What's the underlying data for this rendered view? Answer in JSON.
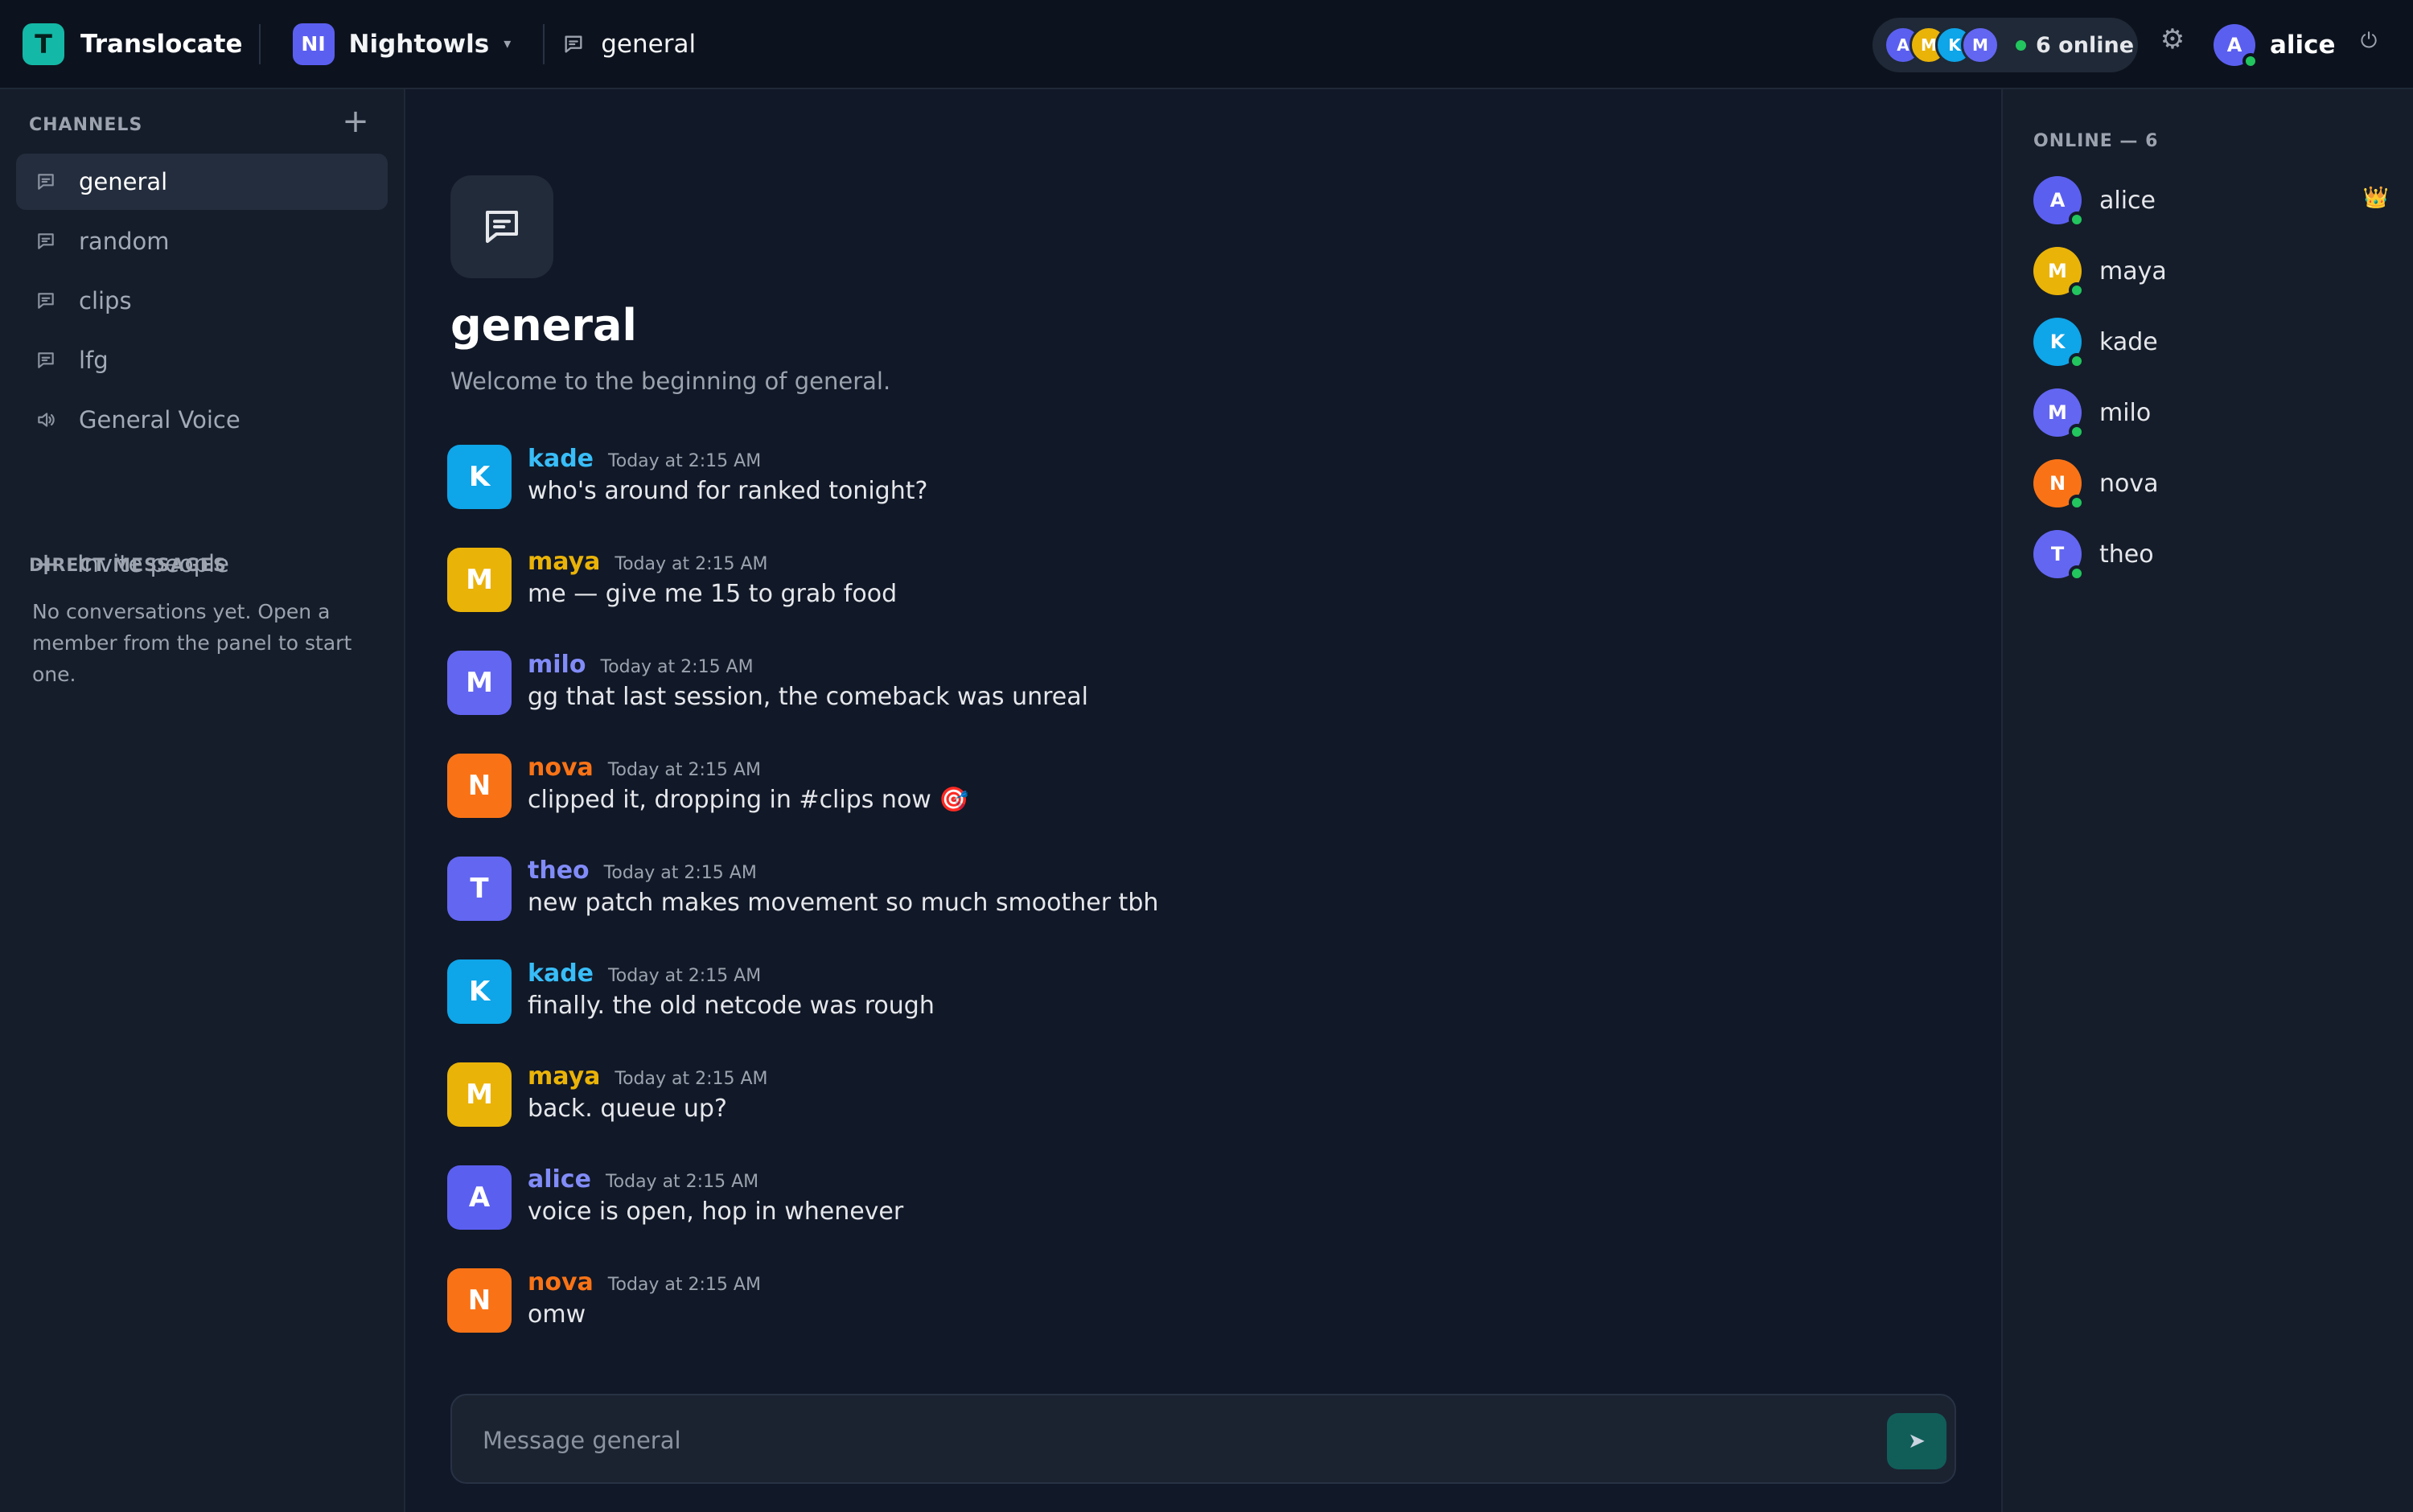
{
  "app": {
    "name": "Translocate",
    "logo_letter": "T"
  },
  "server": {
    "badge": "NI",
    "name": "Nightowls",
    "caret": "▾"
  },
  "current_channel": "general",
  "presence": {
    "avatars": [
      {
        "letter": "A",
        "color": "#5b5ff0"
      },
      {
        "letter": "M",
        "color": "#eab308"
      },
      {
        "letter": "K",
        "color": "#0ea5e9"
      },
      {
        "letter": "M",
        "color": "#6366f1"
      }
    ],
    "label": "6 online"
  },
  "user": {
    "name": "alice",
    "letter": "A"
  },
  "icons": {
    "settings": "⚙",
    "power": "⏻",
    "add": "+",
    "send": "➤",
    "crown": "👑"
  },
  "sidebar": {
    "channels_heading": "CHANNELS",
    "channels": [
      {
        "label": "general",
        "kind": "text",
        "active": true
      },
      {
        "label": "random",
        "kind": "text"
      },
      {
        "label": "clips",
        "kind": "text"
      },
      {
        "label": "lfg",
        "kind": "text"
      },
      {
        "label": "General Voice",
        "kind": "voice"
      }
    ],
    "invite_label": "Invite people",
    "dm_heading": "DIRECT MESSAGES",
    "dm_empty": "No conversations yet. Open a member from the panel to start one."
  },
  "main": {
    "title": "general",
    "subtitle": "Welcome to the beginning of general.",
    "messages": [
      {
        "author": "kade",
        "letter": "K",
        "color": "#0ea5e9",
        "name_color": "#38bdf8",
        "time": "Today at 2:15 AM",
        "text": "who's around for ranked tonight?"
      },
      {
        "author": "maya",
        "letter": "M",
        "color": "#eab308",
        "name_color": "#eab308",
        "time": "Today at 2:15 AM",
        "text": "me — give me 15 to grab food"
      },
      {
        "author": "milo",
        "letter": "M",
        "color": "#6366f1",
        "name_color": "#818cf8",
        "time": "Today at 2:15 AM",
        "text": "gg that last session, the comeback was unreal"
      },
      {
        "author": "nova",
        "letter": "N",
        "color": "#f97316",
        "name_color": "#f97316",
        "time": "Today at 2:15 AM",
        "text": "clipped it, dropping in #clips now 🎯"
      },
      {
        "author": "theo",
        "letter": "T",
        "color": "#6366f1",
        "name_color": "#818cf8",
        "time": "Today at 2:15 AM",
        "text": "new patch makes movement so much smoother tbh"
      },
      {
        "author": "kade",
        "letter": "K",
        "color": "#0ea5e9",
        "name_color": "#38bdf8",
        "time": "Today at 2:15 AM",
        "text": "finally. the old netcode was rough"
      },
      {
        "author": "maya",
        "letter": "M",
        "color": "#eab308",
        "name_color": "#eab308",
        "time": "Today at 2:15 AM",
        "text": "back. queue up?"
      },
      {
        "author": "alice",
        "letter": "A",
        "color": "#5b5ff0",
        "name_color": "#818cf8",
        "time": "Today at 2:15 AM",
        "text": "voice is open, hop in whenever"
      },
      {
        "author": "nova",
        "letter": "N",
        "color": "#f97316",
        "name_color": "#f97316",
        "time": "Today at 2:15 AM",
        "text": "omw"
      }
    ],
    "composer_placeholder": "Message general"
  },
  "members": {
    "heading": "ONLINE — 6",
    "list": [
      {
        "name": "alice",
        "letter": "A",
        "color": "#5b5ff0",
        "owner": true
      },
      {
        "name": "maya",
        "letter": "M",
        "color": "#eab308"
      },
      {
        "name": "kade",
        "letter": "K",
        "color": "#0ea5e9"
      },
      {
        "name": "milo",
        "letter": "M",
        "color": "#6366f1"
      },
      {
        "name": "nova",
        "letter": "N",
        "color": "#f97316"
      },
      {
        "name": "theo",
        "letter": "T",
        "color": "#6366f1"
      }
    ]
  }
}
